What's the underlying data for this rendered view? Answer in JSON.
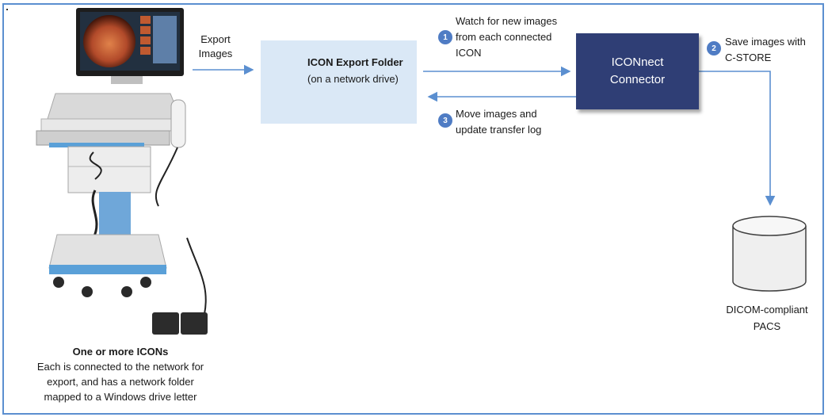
{
  "export_label": [
    "Export",
    "Images"
  ],
  "folder": {
    "title": "ICON Export Folder",
    "subtitle": "(on a network drive)"
  },
  "connector": [
    "ICONnect",
    "Connector"
  ],
  "steps": [
    {
      "num": "1",
      "lines": [
        "Watch for new images",
        "from each connected",
        "ICON"
      ]
    },
    {
      "num": "2",
      "lines": [
        "Save images with",
        "C-STORE"
      ]
    },
    {
      "num": "3",
      "lines": [
        "Move images and",
        "update transfer log"
      ]
    }
  ],
  "pacs": [
    "DICOM-compliant",
    "PACS"
  ],
  "icons_caption": {
    "title": "One or more ICONs",
    "lines": [
      "Each is connected to the network for",
      "export, and has a network folder",
      "mapped to a Windows drive letter"
    ]
  },
  "colors": {
    "frame": "#5b8fd0",
    "arrow": "#5b8fd0",
    "connector": "#2f3e75",
    "folder_bg": "#dae8f6",
    "step_badge": "#4f7cc4"
  }
}
